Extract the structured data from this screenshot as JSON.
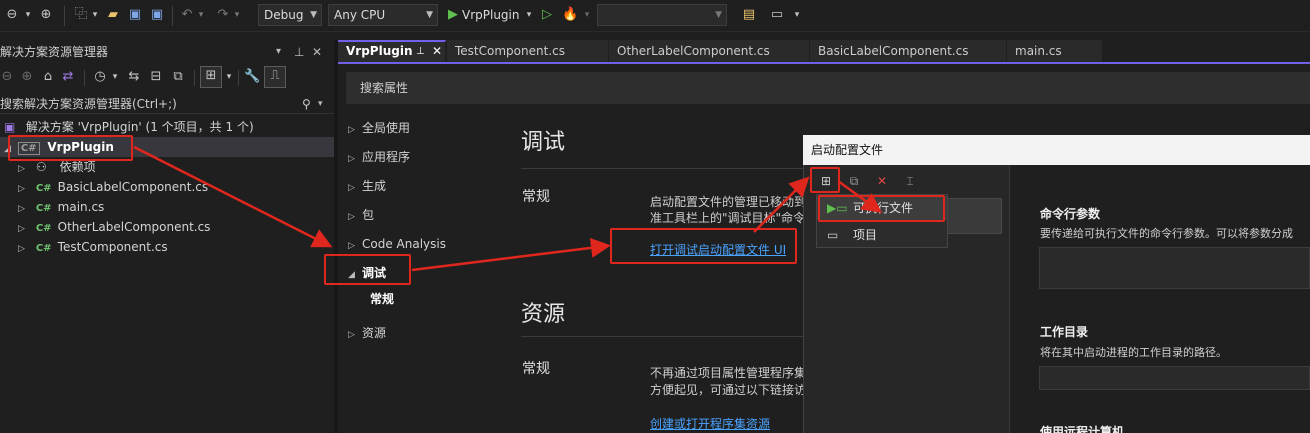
{
  "toolbar": {
    "config": "Debug",
    "platform": "Any CPU",
    "start_target": "VrpPlugin"
  },
  "solution_explorer": {
    "title": "解决方案资源管理器",
    "search_placeholder": "搜索解决方案资源管理器(Ctrl+;)",
    "solution_label": "解决方案 'VrpPlugin' (1 个项目，共 1 个)",
    "project": "VrpPlugin",
    "items": [
      {
        "label": "依赖项",
        "icon": "dependencies-icon"
      },
      {
        "label": "BasicLabelComponent.cs",
        "icon": "csharp-file-icon"
      },
      {
        "label": "main.cs",
        "icon": "csharp-file-icon"
      },
      {
        "label": "OtherLabelComponent.cs",
        "icon": "csharp-file-icon"
      },
      {
        "label": "TestComponent.cs",
        "icon": "csharp-file-icon"
      }
    ]
  },
  "tabs": [
    {
      "label": "VrpPlugin",
      "active": true
    },
    {
      "label": "TestComponent.cs"
    },
    {
      "label": "OtherLabelComponent.cs"
    },
    {
      "label": "BasicLabelComponent.cs"
    },
    {
      "label": "main.cs"
    }
  ],
  "properties": {
    "search_placeholder": "搜索属性",
    "nav": [
      {
        "label": "全局使用"
      },
      {
        "label": "应用程序"
      },
      {
        "label": "生成"
      },
      {
        "label": "包"
      },
      {
        "label": "Code Analysis"
      },
      {
        "label": "调试",
        "expanded": true
      },
      {
        "label": "常规",
        "child": true
      },
      {
        "label": "资源"
      }
    ],
    "debug": {
      "title": "调试",
      "general_title": "常规",
      "desc_line1": "启动配置文件的管理已移动到",
      "desc_line2": "准工具栏上的\"调试目标\"命令",
      "link": "打开调试启动配置文件 UI"
    },
    "resources": {
      "title": "资源",
      "general_title": "常规",
      "desc_line1": "不再通过项目属性管理程序集",
      "desc_line2": "方便起见，可通过以下链接访",
      "link": "创建或打开程序集资源"
    }
  },
  "dialog": {
    "title": "启动配置文件",
    "menu": [
      {
        "label": "可执行文件",
        "icon": "executable-icon"
      },
      {
        "label": "项目",
        "icon": "project-icon"
      }
    ],
    "fields": [
      {
        "label": "命令行参数",
        "desc": "要传递给可执行文件的命令行参数。可以将参数分成"
      },
      {
        "label": "工作目录",
        "desc": "将在其中启动进程的工作目录的路径。"
      },
      {
        "label": "使用远程计算机",
        "desc": ""
      }
    ]
  },
  "colors": {
    "accent": "#7160e8",
    "annotation_red": "#e0271e",
    "link": "#4aa3ff"
  }
}
